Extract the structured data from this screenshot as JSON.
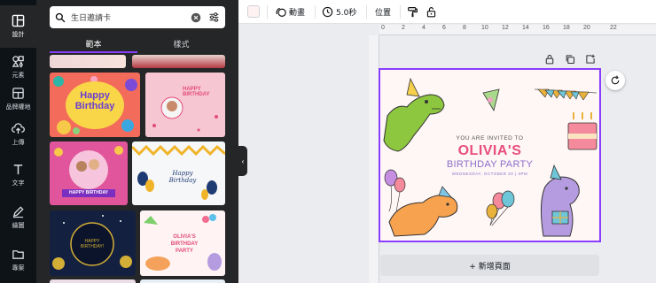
{
  "rail": [
    {
      "label": "設計",
      "icon": "layout-icon"
    },
    {
      "label": "元素",
      "icon": "elements-icon"
    },
    {
      "label": "品牌權地",
      "icon": "brand-icon"
    },
    {
      "label": "上傳",
      "icon": "upload-icon"
    },
    {
      "label": "文字",
      "icon": "text-icon"
    },
    {
      "label": "繪圖",
      "icon": "draw-icon"
    },
    {
      "label": "專案",
      "icon": "folder-icon"
    }
  ],
  "search": {
    "value": "生日邀請卡"
  },
  "tabs": {
    "templates": "範本",
    "styles": "樣式"
  },
  "templates": [
    {
      "title": "Happy Birthday"
    },
    {
      "title": "HAPPY BIRTHDAY"
    },
    {
      "title": "HAPPY BIRTHDAY"
    },
    {
      "title": "Happy Birthday"
    },
    {
      "title": "HAPPY BIRTHDAY!"
    },
    {
      "title": "OLIVIA'S BIRTHDAY PARTY"
    }
  ],
  "toolbar": {
    "animate": "動畫",
    "duration": "5.0秒",
    "position": "位置"
  },
  "ruler": [
    "0",
    "2",
    "4",
    "6",
    "8",
    "10",
    "12",
    "14",
    "16",
    "18",
    "20",
    "22"
  ],
  "card": {
    "invited": "YOU ARE INVITED TO",
    "name": "OLIVIA'S",
    "party": "BIRTHDAY PARTY",
    "date": "WEDNESDAY, OCTOBER 20 | 3PM"
  },
  "add_page": "+ 新增頁面",
  "colors": {
    "accent": "#8b3dff",
    "rail_bg": "#0e1318",
    "panel_bg": "#252627"
  }
}
